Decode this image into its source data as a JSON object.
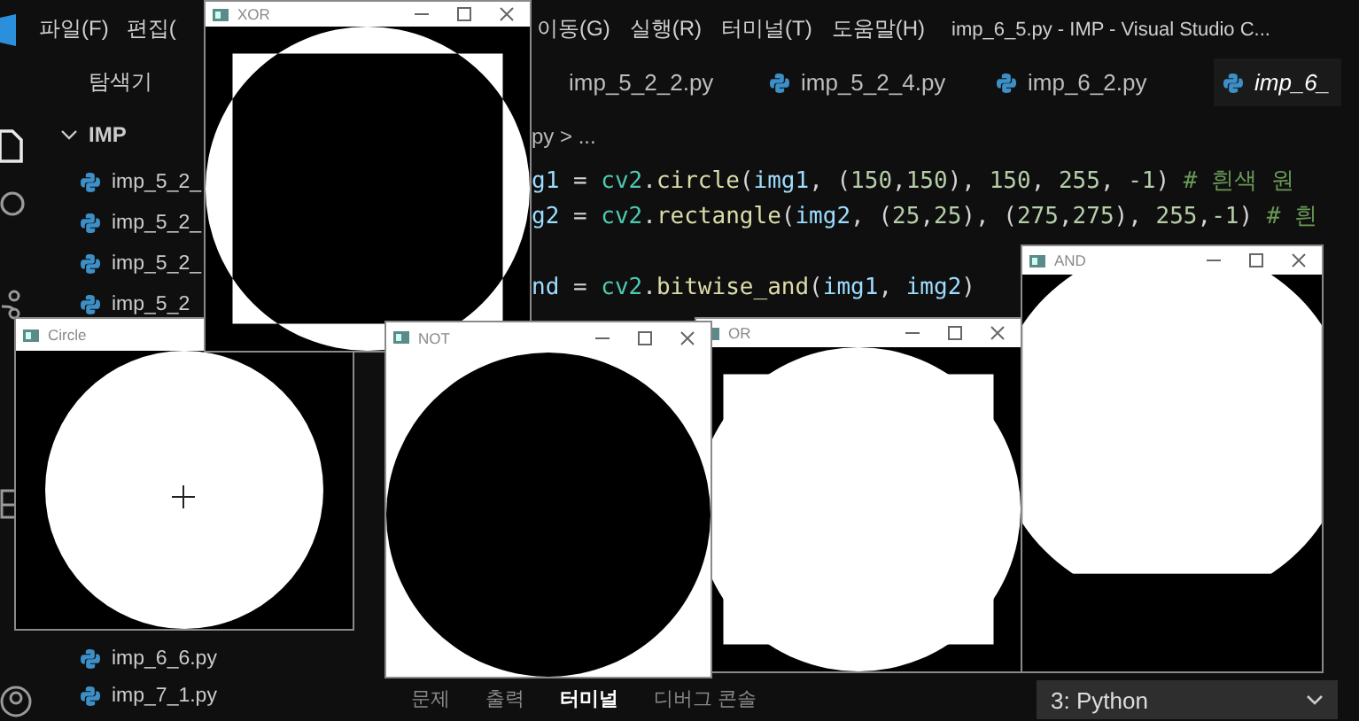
{
  "menu": [
    {
      "label": "파일(F)"
    },
    {
      "label": "편집("
    },
    {
      "label": "이동(G)"
    },
    {
      "label": "실행(R)"
    },
    {
      "label": "터미널(T)"
    },
    {
      "label": "도움말(H)"
    }
  ],
  "window_title": "imp_6_5.py - IMP - Visual Studio C...",
  "explorer": {
    "title": "탐색기",
    "folder": "IMP",
    "expanded": true,
    "files": [
      {
        "name": "imp_5_2_"
      },
      {
        "name": "imp_5_2_"
      },
      {
        "name": "imp_5_2_"
      },
      {
        "name": "imp_5_2"
      }
    ],
    "files_lower": [
      {
        "name": "imp_6_6.py"
      },
      {
        "name": "imp_7_1.py"
      }
    ]
  },
  "tabs": [
    {
      "label": "imp_5_2_2.py",
      "icon": false,
      "selected": false,
      "preview": false
    },
    {
      "label": "imp_5_2_4.py",
      "icon": true,
      "selected": false,
      "preview": false
    },
    {
      "label": "imp_6_2.py",
      "icon": true,
      "selected": false,
      "preview": false
    },
    {
      "label": "imp_6_",
      "icon": true,
      "selected": true,
      "preview": true
    }
  ],
  "breadcrumb": "py > ...",
  "code": [
    [
      {
        "kind": "var",
        "t": "g1"
      },
      {
        "kind": "op",
        "t": " = "
      },
      {
        "kind": "cls",
        "t": "cv2"
      },
      {
        "kind": "op",
        "t": "."
      },
      {
        "kind": "func",
        "t": "circle"
      },
      {
        "kind": "op",
        "t": "("
      },
      {
        "kind": "var",
        "t": "img1"
      },
      {
        "kind": "op",
        "t": ", ("
      },
      {
        "kind": "num",
        "t": "150"
      },
      {
        "kind": "op",
        "t": ","
      },
      {
        "kind": "num",
        "t": "150"
      },
      {
        "kind": "op",
        "t": "), "
      },
      {
        "kind": "num",
        "t": "150"
      },
      {
        "kind": "op",
        "t": ", "
      },
      {
        "kind": "num",
        "t": "255"
      },
      {
        "kind": "op",
        "t": ", "
      },
      {
        "kind": "num",
        "t": "-1"
      },
      {
        "kind": "op",
        "t": ") "
      },
      {
        "kind": "comment",
        "t": "# 흰색 원"
      }
    ],
    [
      {
        "kind": "var",
        "t": "g2"
      },
      {
        "kind": "op",
        "t": " = "
      },
      {
        "kind": "cls",
        "t": "cv2"
      },
      {
        "kind": "op",
        "t": "."
      },
      {
        "kind": "func",
        "t": "rectangle"
      },
      {
        "kind": "op",
        "t": "("
      },
      {
        "kind": "var",
        "t": "img2"
      },
      {
        "kind": "op",
        "t": ", ("
      },
      {
        "kind": "num",
        "t": "25"
      },
      {
        "kind": "op",
        "t": ","
      },
      {
        "kind": "num",
        "t": "25"
      },
      {
        "kind": "op",
        "t": "), ("
      },
      {
        "kind": "num",
        "t": "275"
      },
      {
        "kind": "op",
        "t": ","
      },
      {
        "kind": "num",
        "t": "275"
      },
      {
        "kind": "op",
        "t": "), "
      },
      {
        "kind": "num",
        "t": "255"
      },
      {
        "kind": "op",
        "t": ","
      },
      {
        "kind": "num",
        "t": "-1"
      },
      {
        "kind": "op",
        "t": ") "
      },
      {
        "kind": "comment",
        "t": "# 흰"
      }
    ],
    [
      {
        "kind": "var",
        "t": "nd"
      },
      {
        "kind": "op",
        "t": " = "
      },
      {
        "kind": "cls",
        "t": "cv2"
      },
      {
        "kind": "op",
        "t": "."
      },
      {
        "kind": "func",
        "t": "bitwise_and"
      },
      {
        "kind": "op",
        "t": "("
      },
      {
        "kind": "var",
        "t": "img1"
      },
      {
        "kind": "op",
        "t": ", "
      },
      {
        "kind": "var",
        "t": "img2"
      },
      {
        "kind": "op",
        "t": ")"
      }
    ]
  ],
  "panel_tabs": [
    {
      "label": "문제",
      "selected": false
    },
    {
      "label": "출력",
      "selected": false
    },
    {
      "label": "터미널",
      "selected": true
    },
    {
      "label": "디버그 콘솔",
      "selected": false
    }
  ],
  "terminal_select": "3: Python",
  "image_windows": [
    {
      "title": "XOR",
      "kind": "xor",
      "controls": true,
      "cursor": false
    },
    {
      "title": "AND",
      "kind": "and",
      "controls": true,
      "cursor": false
    },
    {
      "title": "Circle",
      "kind": "circle",
      "controls": false,
      "cursor": true
    },
    {
      "title": "NOT",
      "kind": "not",
      "controls": true,
      "cursor": false
    },
    {
      "title": "OR",
      "kind": "or",
      "controls": true,
      "cursor": false
    }
  ]
}
